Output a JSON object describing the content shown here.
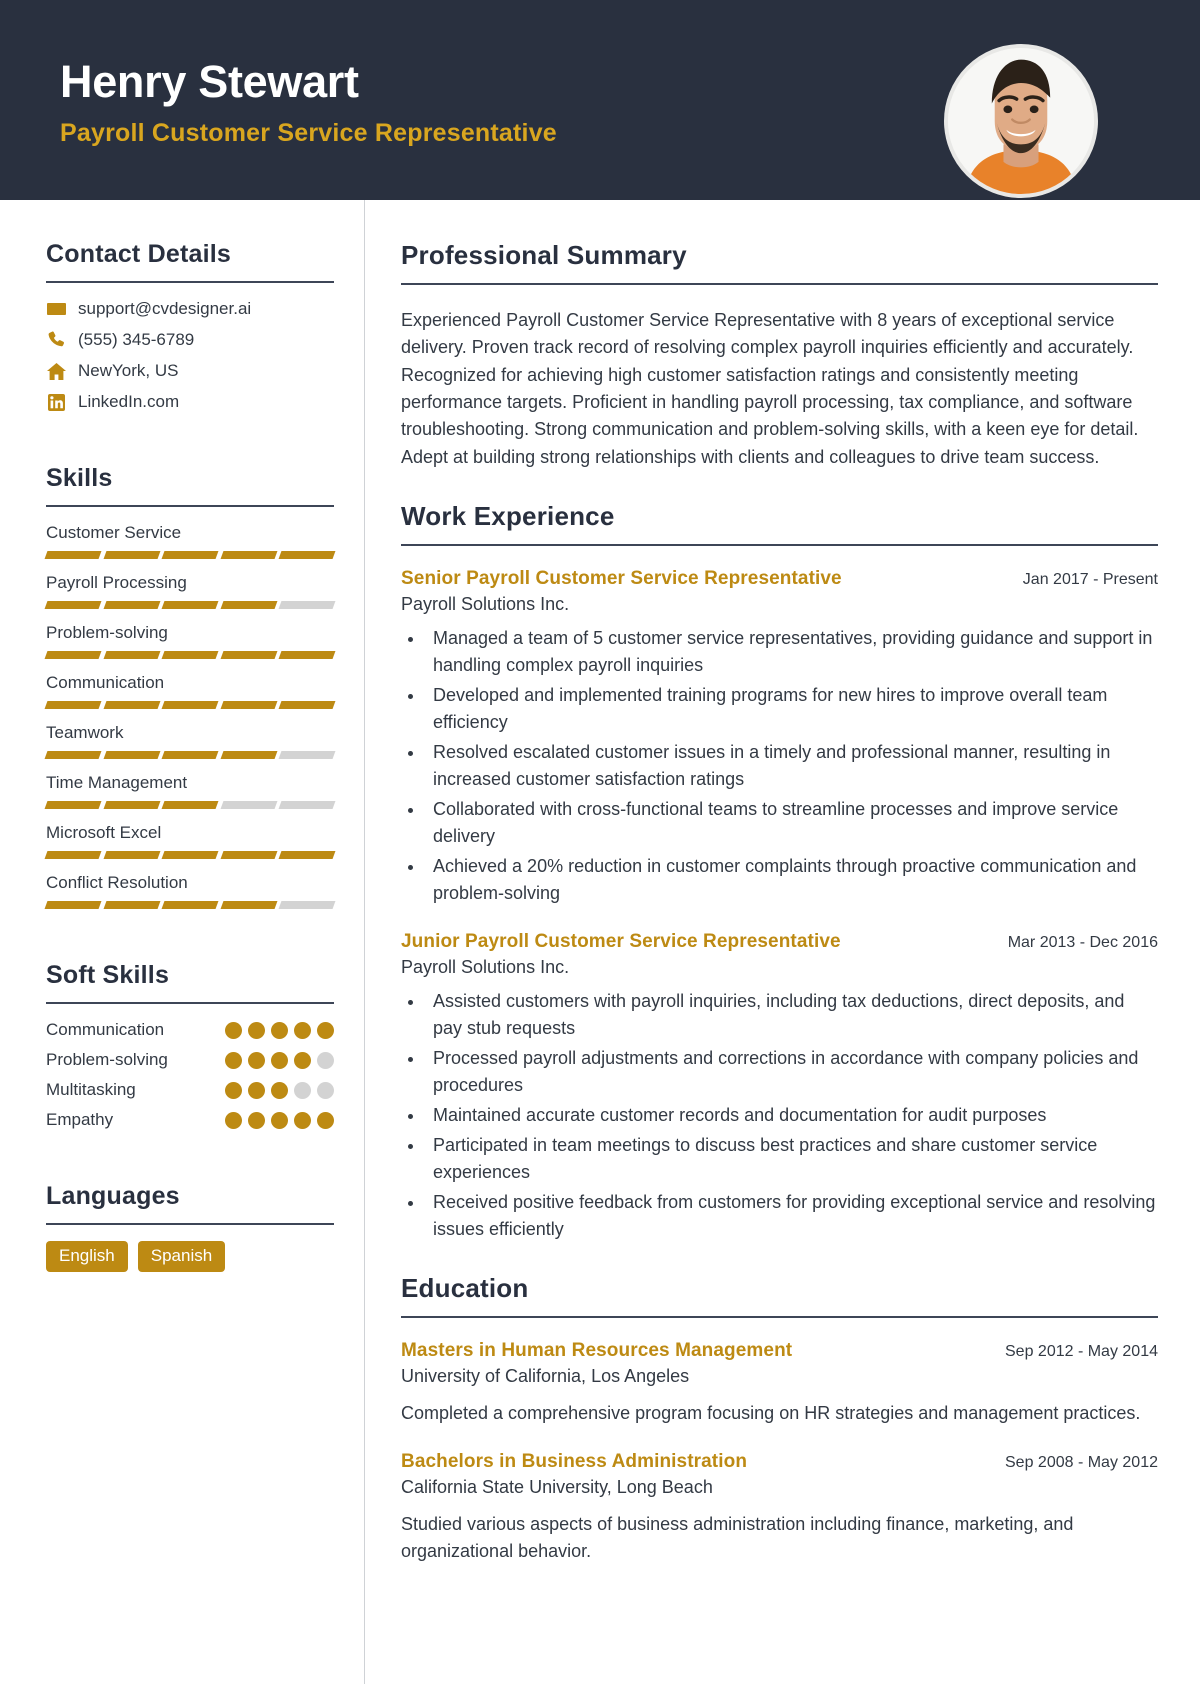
{
  "header": {
    "name": "Henry Stewart",
    "job_title": "Payroll Customer Service Representative",
    "avatar_alt": "profile-photo",
    "bg_color": "#29303f",
    "accent_color": "#d9a61f"
  },
  "sidebar": {
    "contact": {
      "heading": "Contact Details",
      "items": [
        {
          "icon": "envelope-icon",
          "value": "support@cvdesigner.ai"
        },
        {
          "icon": "phone-icon",
          "value": "(555) 345-6789"
        },
        {
          "icon": "home-icon",
          "value": "NewYork, US"
        },
        {
          "icon": "linkedin-icon",
          "value": "LinkedIn.com"
        }
      ]
    },
    "skills": {
      "heading": "Skills",
      "max": 5,
      "items": [
        {
          "name": "Customer Service",
          "level": 5
        },
        {
          "name": "Payroll Processing",
          "level": 4
        },
        {
          "name": "Problem-solving",
          "level": 5
        },
        {
          "name": "Communication",
          "level": 5
        },
        {
          "name": "Teamwork",
          "level": 4
        },
        {
          "name": "Time Management",
          "level": 3
        },
        {
          "name": "Microsoft Excel",
          "level": 5
        },
        {
          "name": "Conflict Resolution",
          "level": 4
        }
      ]
    },
    "soft_skills": {
      "heading": "Soft Skills",
      "max": 5,
      "items": [
        {
          "name": "Communication",
          "level": 5
        },
        {
          "name": "Problem-solving",
          "level": 4
        },
        {
          "name": "Multitasking",
          "level": 3
        },
        {
          "name": "Empathy",
          "level": 5
        }
      ]
    },
    "languages": {
      "heading": "Languages",
      "items": [
        "English",
        "Spanish"
      ]
    }
  },
  "main": {
    "summary": {
      "heading": "Professional Summary",
      "text": "Experienced Payroll Customer Service Representative with 8 years of exceptional service delivery. Proven track record of resolving complex payroll inquiries efficiently and accurately. Recognized for achieving high customer satisfaction ratings and consistently meeting performance targets. Proficient in handling payroll processing, tax compliance, and software troubleshooting. Strong communication and problem-solving skills, with a keen eye for detail. Adept at building strong relationships with clients and colleagues to drive team success."
    },
    "work": {
      "heading": "Work Experience",
      "entries": [
        {
          "title": "Senior Payroll Customer Service Representative",
          "date": "Jan 2017 - Present",
          "org": "Payroll Solutions Inc.",
          "bullets": [
            "Managed a team of 5 customer service representatives, providing guidance and support in handling complex payroll inquiries",
            "Developed and implemented training programs for new hires to improve overall team efficiency",
            "Resolved escalated customer issues in a timely and professional manner, resulting in increased customer satisfaction ratings",
            "Collaborated with cross-functional teams to streamline processes and improve service delivery",
            "Achieved a 20% reduction in customer complaints through proactive communication and problem-solving"
          ]
        },
        {
          "title": "Junior Payroll Customer Service Representative",
          "date": "Mar 2013 - Dec 2016",
          "org": "Payroll Solutions Inc.",
          "bullets": [
            "Assisted customers with payroll inquiries, including tax deductions, direct deposits, and pay stub requests",
            "Processed payroll adjustments and corrections in accordance with company policies and procedures",
            "Maintained accurate customer records and documentation for audit purposes",
            "Participated in team meetings to discuss best practices and share customer service experiences",
            "Received positive feedback from customers for providing exceptional service and resolving issues efficiently"
          ]
        }
      ]
    },
    "education": {
      "heading": "Education",
      "entries": [
        {
          "title": "Masters in Human Resources Management",
          "date": "Sep 2012 - May 2014",
          "org": "University of California, Los Angeles",
          "description": "Completed a comprehensive program focusing on HR strategies and management practices."
        },
        {
          "title": "Bachelors in Business Administration",
          "date": "Sep 2008 - May 2012",
          "org": "California State University, Long Beach",
          "description": "Studied various aspects of business administration including finance, marketing, and organizational behavior."
        }
      ]
    }
  }
}
